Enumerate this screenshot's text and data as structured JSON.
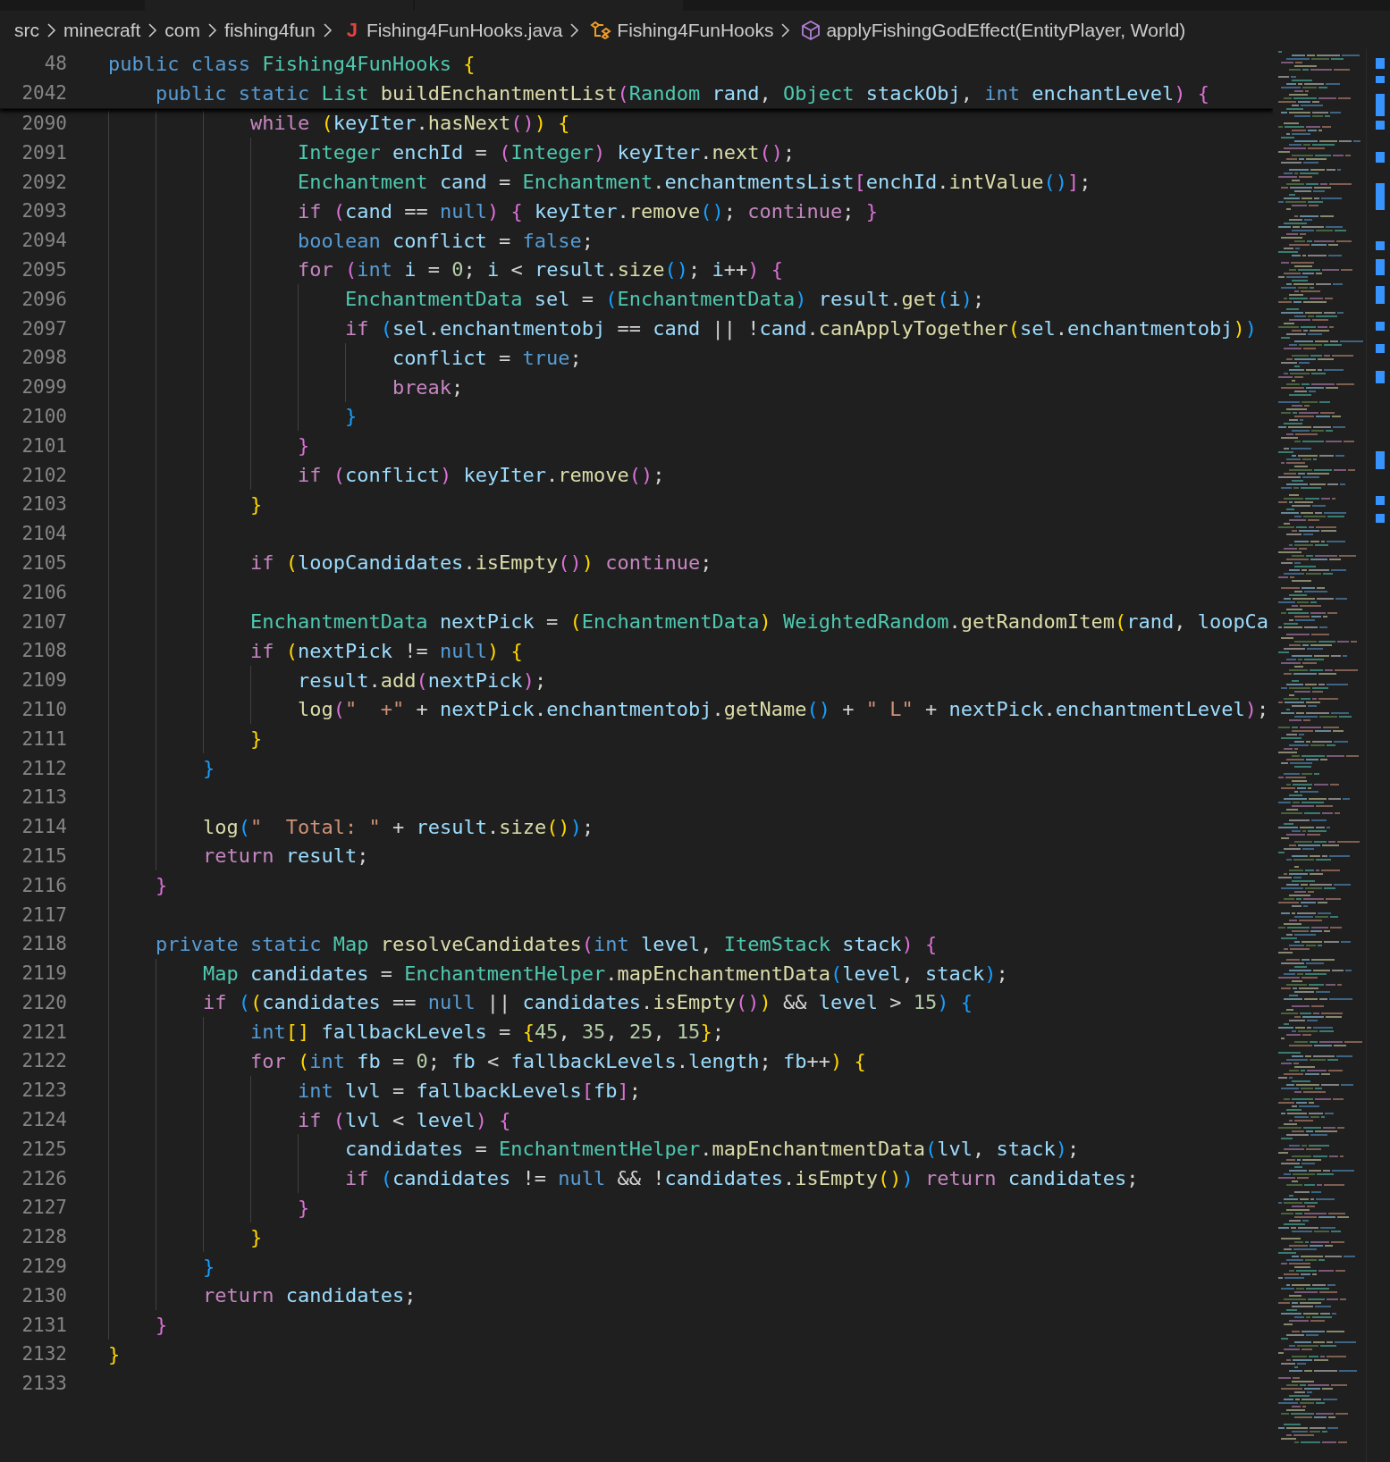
{
  "breadcrumbs": [
    {
      "kind": "folder",
      "label": "src"
    },
    {
      "kind": "folder",
      "label": "minecraft"
    },
    {
      "kind": "folder",
      "label": "com"
    },
    {
      "kind": "folder",
      "label": "fishing4fun"
    },
    {
      "kind": "file",
      "icon": "J",
      "label": "Fishing4FunHooks.java"
    },
    {
      "kind": "class",
      "label": "Fishing4FunHooks"
    },
    {
      "kind": "method",
      "label": "applyFishingGodEffect(EntityPlayer, World)"
    }
  ],
  "editor": {
    "sticky_lines": [
      {
        "number": "48",
        "code": [
          {
            "kind": "kw",
            "text": "public class "
          },
          {
            "kind": "type",
            "text": "Fishing4FunHooks "
          },
          {
            "kind": "br1",
            "text": "{"
          }
        ]
      },
      {
        "number": "2042",
        "code": [
          {
            "kind": "kw",
            "text": "    public static "
          },
          {
            "kind": "type",
            "text": "List "
          },
          {
            "kind": "fn",
            "text": "buildEnchantmentList"
          },
          {
            "kind": "br2",
            "text": "("
          },
          {
            "kind": "type",
            "text": "Random "
          },
          {
            "kind": "var",
            "text": "rand"
          },
          {
            "kind": "op",
            "text": ", "
          },
          {
            "kind": "type",
            "text": "Object "
          },
          {
            "kind": "var",
            "text": "stackObj"
          },
          {
            "kind": "op",
            "text": ", "
          },
          {
            "kind": "kw",
            "text": "int "
          },
          {
            "kind": "var",
            "text": "enchantLevel"
          },
          {
            "kind": "br2",
            "text": ") "
          },
          {
            "kind": "br2",
            "text": "{"
          }
        ]
      }
    ],
    "lines": [
      {
        "number": "2090",
        "code": [
          {
            "kind": "ctrl",
            "text": "            while "
          },
          {
            "kind": "br1",
            "text": "("
          },
          {
            "kind": "var",
            "text": "keyIter"
          },
          {
            "kind": "op",
            "text": "."
          },
          {
            "kind": "fn",
            "text": "hasNext"
          },
          {
            "kind": "br2",
            "text": "()"
          },
          {
            "kind": "br1",
            "text": ") "
          },
          {
            "kind": "br1",
            "text": "{"
          }
        ]
      },
      {
        "number": "2091",
        "code": [
          {
            "kind": "type",
            "text": "                Integer "
          },
          {
            "kind": "var",
            "text": "enchId"
          },
          {
            "kind": "op",
            "text": " = "
          },
          {
            "kind": "br2",
            "text": "("
          },
          {
            "kind": "type",
            "text": "Integer"
          },
          {
            "kind": "br2",
            "text": ") "
          },
          {
            "kind": "var",
            "text": "keyIter"
          },
          {
            "kind": "op",
            "text": "."
          },
          {
            "kind": "fn",
            "text": "next"
          },
          {
            "kind": "br2",
            "text": "()"
          },
          {
            "kind": "op",
            "text": ";"
          }
        ]
      },
      {
        "number": "2092",
        "code": [
          {
            "kind": "type",
            "text": "                Enchantment "
          },
          {
            "kind": "var",
            "text": "cand"
          },
          {
            "kind": "op",
            "text": " = "
          },
          {
            "kind": "type",
            "text": "Enchantment"
          },
          {
            "kind": "op",
            "text": "."
          },
          {
            "kind": "var",
            "text": "enchantmentsList"
          },
          {
            "kind": "br2",
            "text": "["
          },
          {
            "kind": "var",
            "text": "enchId"
          },
          {
            "kind": "op",
            "text": "."
          },
          {
            "kind": "fn",
            "text": "intValue"
          },
          {
            "kind": "br3",
            "text": "()"
          },
          {
            "kind": "br2",
            "text": "]"
          },
          {
            "kind": "op",
            "text": ";"
          }
        ]
      },
      {
        "number": "2093",
        "code": [
          {
            "kind": "ctrl",
            "text": "                if "
          },
          {
            "kind": "br2",
            "text": "("
          },
          {
            "kind": "var",
            "text": "cand"
          },
          {
            "kind": "op",
            "text": " == "
          },
          {
            "kind": "kw",
            "text": "null"
          },
          {
            "kind": "br2",
            "text": ") "
          },
          {
            "kind": "br2",
            "text": "{ "
          },
          {
            "kind": "var",
            "text": "keyIter"
          },
          {
            "kind": "op",
            "text": "."
          },
          {
            "kind": "fn",
            "text": "remove"
          },
          {
            "kind": "br3",
            "text": "()"
          },
          {
            "kind": "op",
            "text": "; "
          },
          {
            "kind": "ctrl",
            "text": "continue"
          },
          {
            "kind": "op",
            "text": "; "
          },
          {
            "kind": "br2",
            "text": "}"
          }
        ]
      },
      {
        "number": "2094",
        "code": [
          {
            "kind": "kw",
            "text": "                boolean "
          },
          {
            "kind": "var",
            "text": "conflict"
          },
          {
            "kind": "op",
            "text": " = "
          },
          {
            "kind": "kw",
            "text": "false"
          },
          {
            "kind": "op",
            "text": ";"
          }
        ]
      },
      {
        "number": "2095",
        "code": [
          {
            "kind": "ctrl",
            "text": "                for "
          },
          {
            "kind": "br2",
            "text": "("
          },
          {
            "kind": "kw",
            "text": "int "
          },
          {
            "kind": "var",
            "text": "i"
          },
          {
            "kind": "op",
            "text": " = "
          },
          {
            "kind": "num",
            "text": "0"
          },
          {
            "kind": "op",
            "text": "; "
          },
          {
            "kind": "var",
            "text": "i"
          },
          {
            "kind": "op",
            "text": " < "
          },
          {
            "kind": "var",
            "text": "result"
          },
          {
            "kind": "op",
            "text": "."
          },
          {
            "kind": "fn",
            "text": "size"
          },
          {
            "kind": "br3",
            "text": "()"
          },
          {
            "kind": "op",
            "text": "; "
          },
          {
            "kind": "var",
            "text": "i"
          },
          {
            "kind": "op",
            "text": "++"
          },
          {
            "kind": "br2",
            "text": ") "
          },
          {
            "kind": "br2",
            "text": "{"
          }
        ]
      },
      {
        "number": "2096",
        "code": [
          {
            "kind": "type",
            "text": "                    EnchantmentData "
          },
          {
            "kind": "var",
            "text": "sel"
          },
          {
            "kind": "op",
            "text": " = "
          },
          {
            "kind": "br3",
            "text": "("
          },
          {
            "kind": "type",
            "text": "EnchantmentData"
          },
          {
            "kind": "br3",
            "text": ") "
          },
          {
            "kind": "var",
            "text": "result"
          },
          {
            "kind": "op",
            "text": "."
          },
          {
            "kind": "fn",
            "text": "get"
          },
          {
            "kind": "br3",
            "text": "("
          },
          {
            "kind": "var",
            "text": "i"
          },
          {
            "kind": "br3",
            "text": ")"
          },
          {
            "kind": "op",
            "text": ";"
          }
        ]
      },
      {
        "number": "2097",
        "code": [
          {
            "kind": "ctrl",
            "text": "                    if "
          },
          {
            "kind": "br3",
            "text": "("
          },
          {
            "kind": "var",
            "text": "sel"
          },
          {
            "kind": "op",
            "text": "."
          },
          {
            "kind": "var",
            "text": "enchantmentobj"
          },
          {
            "kind": "op",
            "text": " == "
          },
          {
            "kind": "var",
            "text": "cand"
          },
          {
            "kind": "op",
            "text": " || !"
          },
          {
            "kind": "var",
            "text": "cand"
          },
          {
            "kind": "op",
            "text": "."
          },
          {
            "kind": "fn",
            "text": "canApplyTogether"
          },
          {
            "kind": "br1",
            "text": "("
          },
          {
            "kind": "var",
            "text": "sel"
          },
          {
            "kind": "op",
            "text": "."
          },
          {
            "kind": "var",
            "text": "enchantmentobj"
          },
          {
            "kind": "br1",
            "text": ")"
          },
          {
            "kind": "br3",
            "text": ")"
          }
        ]
      },
      {
        "number": "2098",
        "code": [
          {
            "kind": "var",
            "text": "                        conflict"
          },
          {
            "kind": "op",
            "text": " = "
          },
          {
            "kind": "kw",
            "text": "true"
          },
          {
            "kind": "op",
            "text": ";"
          }
        ]
      },
      {
        "number": "2099",
        "code": [
          {
            "kind": "ctrl",
            "text": "                        break"
          },
          {
            "kind": "op",
            "text": ";"
          }
        ]
      },
      {
        "number": "2100",
        "code": [
          {
            "kind": "br3",
            "text": "                    }"
          }
        ]
      },
      {
        "number": "2101",
        "code": [
          {
            "kind": "br2",
            "text": "                }"
          }
        ]
      },
      {
        "number": "2102",
        "code": [
          {
            "kind": "ctrl",
            "text": "                if "
          },
          {
            "kind": "br2",
            "text": "("
          },
          {
            "kind": "var",
            "text": "conflict"
          },
          {
            "kind": "br2",
            "text": ") "
          },
          {
            "kind": "var",
            "text": "keyIter"
          },
          {
            "kind": "op",
            "text": "."
          },
          {
            "kind": "fn",
            "text": "remove"
          },
          {
            "kind": "br2",
            "text": "()"
          },
          {
            "kind": "op",
            "text": ";"
          }
        ]
      },
      {
        "number": "2103",
        "code": [
          {
            "kind": "br1",
            "text": "            }"
          }
        ]
      },
      {
        "number": "2104"
      },
      {
        "number": "2105",
        "code": [
          {
            "kind": "ctrl",
            "text": "            if "
          },
          {
            "kind": "br1",
            "text": "("
          },
          {
            "kind": "var",
            "text": "loopCandidates"
          },
          {
            "kind": "op",
            "text": "."
          },
          {
            "kind": "fn",
            "text": "isEmpty"
          },
          {
            "kind": "br2",
            "text": "()"
          },
          {
            "kind": "br1",
            "text": ") "
          },
          {
            "kind": "ctrl",
            "text": "continue"
          },
          {
            "kind": "op",
            "text": ";"
          }
        ]
      },
      {
        "number": "2106"
      },
      {
        "number": "2107",
        "code": [
          {
            "kind": "type",
            "text": "            EnchantmentData "
          },
          {
            "kind": "var",
            "text": "nextPick"
          },
          {
            "kind": "op",
            "text": " = "
          },
          {
            "kind": "br1",
            "text": "("
          },
          {
            "kind": "type",
            "text": "EnchantmentData"
          },
          {
            "kind": "br1",
            "text": ") "
          },
          {
            "kind": "type",
            "text": "WeightedRandom"
          },
          {
            "kind": "op",
            "text": "."
          },
          {
            "kind": "fn",
            "text": "getRandomItem"
          },
          {
            "kind": "br1",
            "text": "("
          },
          {
            "kind": "var",
            "text": "rand"
          },
          {
            "kind": "op",
            "text": ", "
          },
          {
            "kind": "var",
            "text": "loopCa"
          }
        ]
      },
      {
        "number": "2108",
        "code": [
          {
            "kind": "ctrl",
            "text": "            if "
          },
          {
            "kind": "br1",
            "text": "("
          },
          {
            "kind": "var",
            "text": "nextPick"
          },
          {
            "kind": "op",
            "text": " != "
          },
          {
            "kind": "kw",
            "text": "null"
          },
          {
            "kind": "br1",
            "text": ") "
          },
          {
            "kind": "br1",
            "text": "{"
          }
        ]
      },
      {
        "number": "2109",
        "code": [
          {
            "kind": "var",
            "text": "                result"
          },
          {
            "kind": "op",
            "text": "."
          },
          {
            "kind": "fn",
            "text": "add"
          },
          {
            "kind": "br2",
            "text": "("
          },
          {
            "kind": "var",
            "text": "nextPick"
          },
          {
            "kind": "br2",
            "text": ")"
          },
          {
            "kind": "op",
            "text": ";"
          }
        ]
      },
      {
        "number": "2110",
        "code": [
          {
            "kind": "fn",
            "text": "                log"
          },
          {
            "kind": "br2",
            "text": "("
          },
          {
            "kind": "str",
            "text": "\"  +\""
          },
          {
            "kind": "op",
            "text": " + "
          },
          {
            "kind": "var",
            "text": "nextPick"
          },
          {
            "kind": "op",
            "text": "."
          },
          {
            "kind": "var",
            "text": "enchantmentobj"
          },
          {
            "kind": "op",
            "text": "."
          },
          {
            "kind": "fn",
            "text": "getName"
          },
          {
            "kind": "br3",
            "text": "()"
          },
          {
            "kind": "op",
            "text": " + "
          },
          {
            "kind": "str",
            "text": "\" L\""
          },
          {
            "kind": "op",
            "text": " + "
          },
          {
            "kind": "var",
            "text": "nextPick"
          },
          {
            "kind": "op",
            "text": "."
          },
          {
            "kind": "var",
            "text": "enchantmentLevel"
          },
          {
            "kind": "br2",
            "text": ")"
          },
          {
            "kind": "op",
            "text": ";"
          }
        ]
      },
      {
        "number": "2111",
        "code": [
          {
            "kind": "br1",
            "text": "            }"
          }
        ]
      },
      {
        "number": "2112",
        "code": [
          {
            "kind": "br3",
            "text": "        }"
          }
        ]
      },
      {
        "number": "2113"
      },
      {
        "number": "2114",
        "code": [
          {
            "kind": "fn",
            "text": "        log"
          },
          {
            "kind": "br3",
            "text": "("
          },
          {
            "kind": "str",
            "text": "\"  Total: \""
          },
          {
            "kind": "op",
            "text": " + "
          },
          {
            "kind": "var",
            "text": "result"
          },
          {
            "kind": "op",
            "text": "."
          },
          {
            "kind": "fn",
            "text": "size"
          },
          {
            "kind": "br1",
            "text": "()"
          },
          {
            "kind": "br3",
            "text": ")"
          },
          {
            "kind": "op",
            "text": ";"
          }
        ]
      },
      {
        "number": "2115",
        "code": [
          {
            "kind": "ctrl",
            "text": "        return "
          },
          {
            "kind": "var",
            "text": "result"
          },
          {
            "kind": "op",
            "text": ";"
          }
        ]
      },
      {
        "number": "2116",
        "code": [
          {
            "kind": "br2",
            "text": "    }"
          }
        ]
      },
      {
        "number": "2117"
      },
      {
        "number": "2118",
        "code": [
          {
            "kind": "kw",
            "text": "    private static "
          },
          {
            "kind": "type",
            "text": "Map "
          },
          {
            "kind": "fn",
            "text": "resolveCandidates"
          },
          {
            "kind": "br2",
            "text": "("
          },
          {
            "kind": "kw",
            "text": "int "
          },
          {
            "kind": "var",
            "text": "level"
          },
          {
            "kind": "op",
            "text": ", "
          },
          {
            "kind": "type",
            "text": "ItemStack "
          },
          {
            "kind": "var",
            "text": "stack"
          },
          {
            "kind": "br2",
            "text": ") "
          },
          {
            "kind": "br2",
            "text": "{"
          }
        ]
      },
      {
        "number": "2119",
        "code": [
          {
            "kind": "type",
            "text": "        Map "
          },
          {
            "kind": "var",
            "text": "candidates"
          },
          {
            "kind": "op",
            "text": " = "
          },
          {
            "kind": "type",
            "text": "EnchantmentHelper"
          },
          {
            "kind": "op",
            "text": "."
          },
          {
            "kind": "fn",
            "text": "mapEnchantmentData"
          },
          {
            "kind": "br3",
            "text": "("
          },
          {
            "kind": "var",
            "text": "level"
          },
          {
            "kind": "op",
            "text": ", "
          },
          {
            "kind": "var",
            "text": "stack"
          },
          {
            "kind": "br3",
            "text": ")"
          },
          {
            "kind": "op",
            "text": ";"
          }
        ]
      },
      {
        "number": "2120",
        "code": [
          {
            "kind": "ctrl",
            "text": "        if "
          },
          {
            "kind": "br3",
            "text": "("
          },
          {
            "kind": "br1",
            "text": "("
          },
          {
            "kind": "var",
            "text": "candidates"
          },
          {
            "kind": "op",
            "text": " == "
          },
          {
            "kind": "kw",
            "text": "null"
          },
          {
            "kind": "op",
            "text": " || "
          },
          {
            "kind": "var",
            "text": "candidates"
          },
          {
            "kind": "op",
            "text": "."
          },
          {
            "kind": "fn",
            "text": "isEmpty"
          },
          {
            "kind": "br2",
            "text": "()"
          },
          {
            "kind": "br1",
            "text": ")"
          },
          {
            "kind": "op",
            "text": " && "
          },
          {
            "kind": "var",
            "text": "level"
          },
          {
            "kind": "op",
            "text": " > "
          },
          {
            "kind": "num",
            "text": "15"
          },
          {
            "kind": "br3",
            "text": ") "
          },
          {
            "kind": "br3",
            "text": "{"
          }
        ]
      },
      {
        "number": "2121",
        "code": [
          {
            "kind": "kw",
            "text": "            int"
          },
          {
            "kind": "br1",
            "text": "[] "
          },
          {
            "kind": "var",
            "text": "fallbackLevels"
          },
          {
            "kind": "op",
            "text": " = "
          },
          {
            "kind": "br1",
            "text": "{"
          },
          {
            "kind": "num",
            "text": "45"
          },
          {
            "kind": "op",
            "text": ", "
          },
          {
            "kind": "num",
            "text": "35"
          },
          {
            "kind": "op",
            "text": ", "
          },
          {
            "kind": "num",
            "text": "25"
          },
          {
            "kind": "op",
            "text": ", "
          },
          {
            "kind": "num",
            "text": "15"
          },
          {
            "kind": "br1",
            "text": "}"
          },
          {
            "kind": "op",
            "text": ";"
          }
        ]
      },
      {
        "number": "2122",
        "code": [
          {
            "kind": "ctrl",
            "text": "            for "
          },
          {
            "kind": "br1",
            "text": "("
          },
          {
            "kind": "kw",
            "text": "int "
          },
          {
            "kind": "var",
            "text": "fb"
          },
          {
            "kind": "op",
            "text": " = "
          },
          {
            "kind": "num",
            "text": "0"
          },
          {
            "kind": "op",
            "text": "; "
          },
          {
            "kind": "var",
            "text": "fb"
          },
          {
            "kind": "op",
            "text": " < "
          },
          {
            "kind": "var",
            "text": "fallbackLevels"
          },
          {
            "kind": "op",
            "text": "."
          },
          {
            "kind": "var",
            "text": "length"
          },
          {
            "kind": "op",
            "text": "; "
          },
          {
            "kind": "var",
            "text": "fb"
          },
          {
            "kind": "op",
            "text": "++"
          },
          {
            "kind": "br1",
            "text": ") "
          },
          {
            "kind": "br1",
            "text": "{"
          }
        ]
      },
      {
        "number": "2123",
        "code": [
          {
            "kind": "kw",
            "text": "                int "
          },
          {
            "kind": "var",
            "text": "lvl"
          },
          {
            "kind": "op",
            "text": " = "
          },
          {
            "kind": "var",
            "text": "fallbackLevels"
          },
          {
            "kind": "br2",
            "text": "["
          },
          {
            "kind": "var",
            "text": "fb"
          },
          {
            "kind": "br2",
            "text": "]"
          },
          {
            "kind": "op",
            "text": ";"
          }
        ]
      },
      {
        "number": "2124",
        "code": [
          {
            "kind": "ctrl",
            "text": "                if "
          },
          {
            "kind": "br2",
            "text": "("
          },
          {
            "kind": "var",
            "text": "lvl"
          },
          {
            "kind": "op",
            "text": " < "
          },
          {
            "kind": "var",
            "text": "level"
          },
          {
            "kind": "br2",
            "text": ") "
          },
          {
            "kind": "br2",
            "text": "{"
          }
        ]
      },
      {
        "number": "2125",
        "code": [
          {
            "kind": "var",
            "text": "                    candidates"
          },
          {
            "kind": "op",
            "text": " = "
          },
          {
            "kind": "type",
            "text": "EnchantmentHelper"
          },
          {
            "kind": "op",
            "text": "."
          },
          {
            "kind": "fn",
            "text": "mapEnchantmentData"
          },
          {
            "kind": "br3",
            "text": "("
          },
          {
            "kind": "var",
            "text": "lvl"
          },
          {
            "kind": "op",
            "text": ", "
          },
          {
            "kind": "var",
            "text": "stack"
          },
          {
            "kind": "br3",
            "text": ")"
          },
          {
            "kind": "op",
            "text": ";"
          }
        ]
      },
      {
        "number": "2126",
        "code": [
          {
            "kind": "ctrl",
            "text": "                    if "
          },
          {
            "kind": "br3",
            "text": "("
          },
          {
            "kind": "var",
            "text": "candidates"
          },
          {
            "kind": "op",
            "text": " != "
          },
          {
            "kind": "kw",
            "text": "null"
          },
          {
            "kind": "op",
            "text": " && !"
          },
          {
            "kind": "var",
            "text": "candidates"
          },
          {
            "kind": "op",
            "text": "."
          },
          {
            "kind": "fn",
            "text": "isEmpty"
          },
          {
            "kind": "br1",
            "text": "()"
          },
          {
            "kind": "br3",
            "text": ") "
          },
          {
            "kind": "ctrl",
            "text": "return "
          },
          {
            "kind": "var",
            "text": "candidates"
          },
          {
            "kind": "op",
            "text": ";"
          }
        ]
      },
      {
        "number": "2127",
        "code": [
          {
            "kind": "br2",
            "text": "                }"
          }
        ]
      },
      {
        "number": "2128",
        "code": [
          {
            "kind": "br1",
            "text": "            }"
          }
        ]
      },
      {
        "number": "2129",
        "code": [
          {
            "kind": "br3",
            "text": "        }"
          }
        ]
      },
      {
        "number": "2130",
        "code": [
          {
            "kind": "ctrl",
            "text": "        return "
          },
          {
            "kind": "var",
            "text": "candidates"
          },
          {
            "kind": "op",
            "text": ";"
          }
        ]
      },
      {
        "number": "2131",
        "code": [
          {
            "kind": "br2",
            "text": "    }"
          }
        ]
      },
      {
        "number": "2132",
        "code": [
          {
            "kind": "br1",
            "text": "}"
          }
        ]
      },
      {
        "number": "2133"
      }
    ]
  }
}
